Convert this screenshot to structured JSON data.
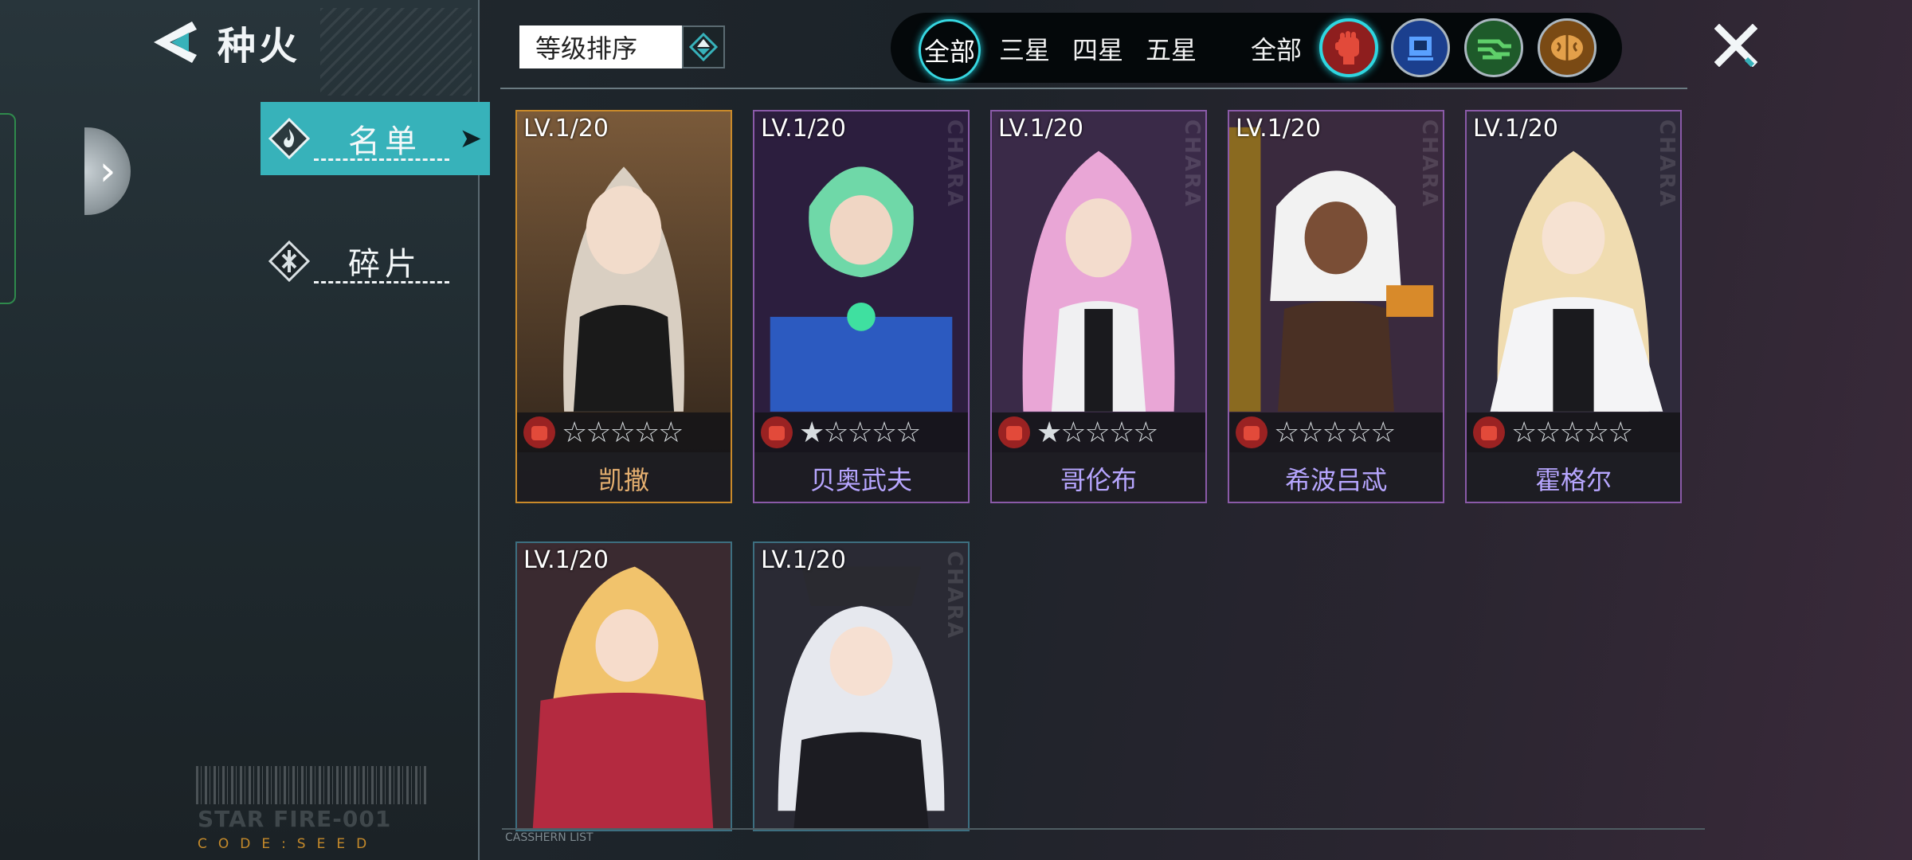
{
  "header": {
    "title": "种火"
  },
  "sidebar": {
    "tabs": [
      {
        "label": "名单",
        "active": true
      },
      {
        "label": "碎片",
        "active": false
      }
    ],
    "branding": {
      "brand": "STAR FIRE-001",
      "code": "CODE:SEED"
    }
  },
  "toolbar": {
    "sort_label": "等级排序"
  },
  "filters": {
    "rarity": [
      "全部",
      "三星",
      "四星",
      "五星"
    ],
    "type_all": "全部",
    "types": [
      "fist-icon",
      "chip-icon",
      "circuit-icon",
      "brain-icon"
    ]
  },
  "cards": [
    {
      "level": "LV.1/20",
      "name": "凯撒",
      "stars": "☆☆☆☆☆",
      "frame": "gold"
    },
    {
      "level": "LV.1/20",
      "name": "贝奥武夫",
      "stars": "★☆☆☆☆",
      "frame": "purple"
    },
    {
      "level": "LV.1/20",
      "name": "哥伦布",
      "stars": "★☆☆☆☆",
      "frame": "purple"
    },
    {
      "level": "LV.1/20",
      "name": "希波吕忒",
      "stars": "☆☆☆☆☆",
      "frame": "purple"
    },
    {
      "level": "LV.1/20",
      "name": "霍格尔",
      "stars": "☆☆☆☆☆",
      "frame": "purple"
    },
    {
      "level": "LV.1/20",
      "name": "",
      "stars": "",
      "frame": "teal"
    },
    {
      "level": "LV.1/20",
      "name": "",
      "stars": "",
      "frame": "teal"
    }
  ],
  "footer": {
    "list_tag": "CASSHERN LIST"
  },
  "colors": {
    "accent": "#37b2ba",
    "gold_frame": "#c98a2a",
    "purple_frame": "#8a5aa8",
    "name_gold": "#e6b070",
    "name_purple": "#b7a6ff"
  }
}
